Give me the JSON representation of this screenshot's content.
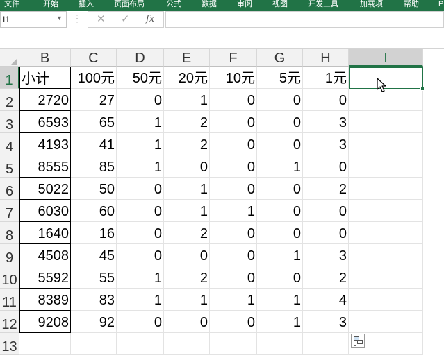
{
  "ribbon": {
    "tabs": [
      "文件",
      "开始",
      "插入",
      "页面布局",
      "公式",
      "数据",
      "审阅",
      "视图",
      "开发工具",
      "加载项",
      "帮助",
      "P"
    ]
  },
  "formula_bar": {
    "name_box": "I1",
    "separator": "⋮",
    "cancel_symbol": "✕",
    "enter_symbol": "✓",
    "fx_symbol": "fx",
    "formula": ""
  },
  "sheet": {
    "column_headers": [
      "B",
      "C",
      "D",
      "E",
      "F",
      "G",
      "H",
      "I"
    ],
    "active_column": "I",
    "active_row": "1",
    "row_numbers": [
      "1",
      "2",
      "3",
      "4",
      "5",
      "6",
      "7",
      "8",
      "9",
      "10",
      "11",
      "12",
      "13"
    ],
    "header_row": [
      "小计",
      "100元",
      "50元",
      "20元",
      "10元",
      "5元",
      "1元",
      ""
    ],
    "rows": [
      [
        "2720",
        "27",
        "0",
        "1",
        "0",
        "0",
        "0"
      ],
      [
        "6593",
        "65",
        "1",
        "2",
        "0",
        "0",
        "3"
      ],
      [
        "4193",
        "41",
        "1",
        "2",
        "0",
        "0",
        "3"
      ],
      [
        "8555",
        "85",
        "1",
        "0",
        "0",
        "1",
        "0"
      ],
      [
        "5022",
        "50",
        "0",
        "1",
        "0",
        "0",
        "2"
      ],
      [
        "6030",
        "60",
        "0",
        "1",
        "1",
        "0",
        "0"
      ],
      [
        "1640",
        "16",
        "0",
        "2",
        "0",
        "0",
        "0"
      ],
      [
        "4508",
        "45",
        "0",
        "0",
        "0",
        "1",
        "3"
      ],
      [
        "5592",
        "55",
        "1",
        "2",
        "0",
        "0",
        "2"
      ],
      [
        "8389",
        "83",
        "1",
        "1",
        "1",
        "1",
        "4"
      ],
      [
        "9208",
        "92",
        "0",
        "0",
        "0",
        "1",
        "3"
      ]
    ]
  },
  "colors": {
    "accent": "#217346",
    "ribbon_bg": "#217346",
    "header_bg": "#f2f2f2"
  },
  "icons": {
    "cursor": "mouse-pointer-icon",
    "quick_analysis": "quick-analysis-icon"
  }
}
